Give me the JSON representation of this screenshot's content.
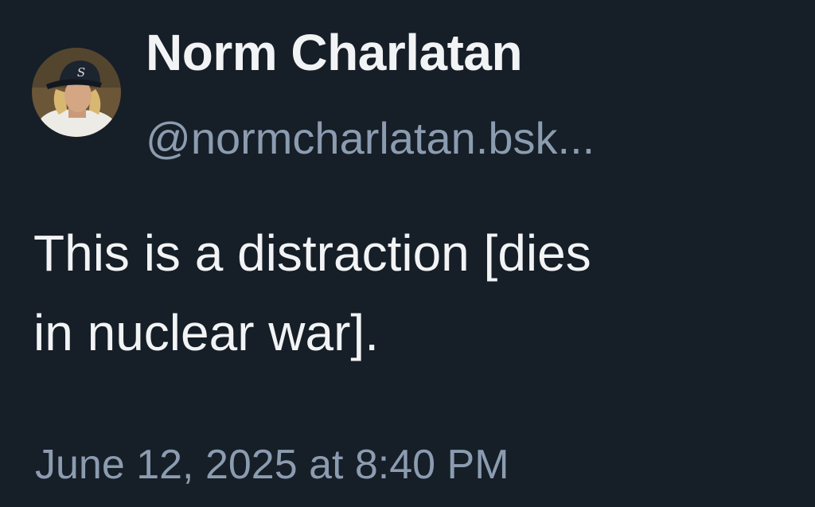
{
  "post": {
    "author": {
      "display_name": "Norm Charlatan",
      "handle": "@normcharlatan.bsk...",
      "avatar_icon": "avatar-photo-baseball-player"
    },
    "text": "This is a distraction [dies\nin nuclear war].",
    "timestamp": "June 12, 2025 at 8:40 PM"
  },
  "colors": {
    "background": "#161e27",
    "text_primary": "#f1f3f5",
    "text_secondary": "#8c9cb0"
  }
}
